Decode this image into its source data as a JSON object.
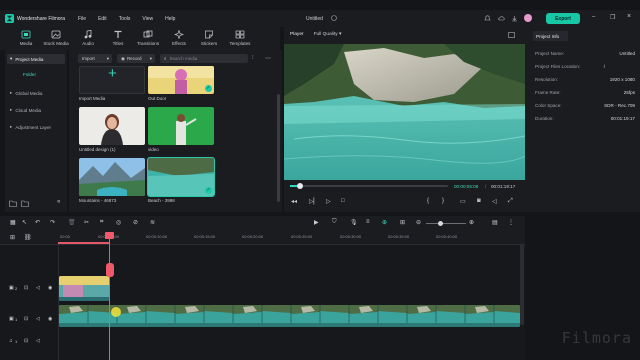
{
  "app": {
    "name": "Wondershare Filmora",
    "menu": [
      "File",
      "Edit",
      "Tools",
      "View",
      "Help"
    ],
    "document_title": "Untitled",
    "export_label": "Export"
  },
  "toolbar": {
    "tabs": [
      {
        "label": "Media",
        "icon": "media-icon",
        "active": true
      },
      {
        "label": "Stock Media",
        "icon": "stock-media-icon",
        "active": false
      },
      {
        "label": "Audio",
        "icon": "music-note-icon",
        "active": false
      },
      {
        "label": "Titles",
        "icon": "titles-icon",
        "active": false
      },
      {
        "label": "Transitions",
        "icon": "transitions-icon",
        "active": false
      },
      {
        "label": "Effects",
        "icon": "effects-icon",
        "active": false
      },
      {
        "label": "Stickers",
        "icon": "stickers-icon",
        "active": false
      },
      {
        "label": "Templates",
        "icon": "templates-icon",
        "active": false
      }
    ]
  },
  "left_nav": {
    "project_media": "Project Media",
    "folder": "Folder",
    "items": [
      "Global Media",
      "Cloud Media",
      "Adjustment Layer"
    ]
  },
  "media": {
    "import_label": "Import",
    "record_label": "Record",
    "search_placeholder": "Search media",
    "items": [
      {
        "label": "Import Media",
        "kind": "import"
      },
      {
        "label": "Out Door",
        "kind": "outdoor"
      },
      {
        "label": "Untitled design (1)",
        "kind": "person"
      },
      {
        "label": "video",
        "kind": "greenscreen"
      },
      {
        "label": "Mountains - 46873",
        "kind": "mountains"
      },
      {
        "label": "Beach - 3998",
        "kind": "beach",
        "selected": true
      }
    ]
  },
  "player": {
    "tab_player": "Player",
    "quality": "Full Quality",
    "current_time": "00:00:05:08",
    "total_time": "00:01:19:17",
    "progress": 0.066
  },
  "project_info": {
    "tab": "Project Info",
    "rows": [
      {
        "label": "Project Name:",
        "value": "Untitled"
      },
      {
        "label": "Project Files Location:",
        "value": "/"
      },
      {
        "label": "Resolution:",
        "value": "1920 x 1080"
      },
      {
        "label": "Frame Rate:",
        "value": "25fps"
      },
      {
        "label": "Color Space:",
        "value": "SDR - Rec.709"
      },
      {
        "label": "Duration:",
        "value": "00:01:19:17"
      }
    ]
  },
  "timeline": {
    "ticks": [
      "00:00",
      "00:00:05:00",
      "00:00:10:00",
      "00:00:15:00",
      "00:00:20:00",
      "00:00:25:00",
      "00:00:30:00",
      "00:00:35:00",
      "00:00:40:00"
    ],
    "track_labels": [
      "2",
      "1",
      "1"
    ],
    "watermark": "Filmora"
  },
  "colors": {
    "accent": "#17c7a6",
    "playhead": "#ef5a6a",
    "panel": "#1b1c20",
    "background": "#141518"
  }
}
